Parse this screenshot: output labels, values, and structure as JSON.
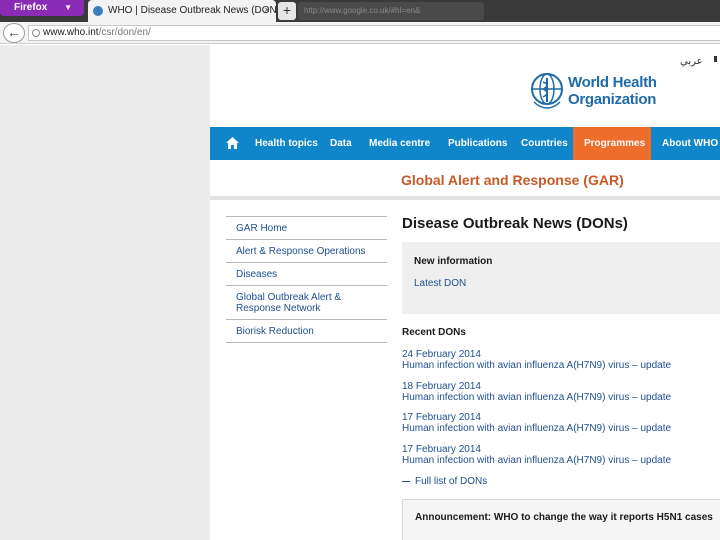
{
  "browser": {
    "app_button_label": "Firefox",
    "tab_title": "WHO | Disease Outbreak News (DONs)",
    "tab_close": "×",
    "new_tab": "+",
    "ghost_tab_text": "http://www.google.co.uk/#hl=en&",
    "url_host": "www.who.int",
    "url_path": "/csr/don/en/"
  },
  "header": {
    "language_link": "عربي",
    "logo_line1": "World Health",
    "logo_line2": "Organization"
  },
  "topnav": {
    "items": [
      {
        "label": "Health topics"
      },
      {
        "label": "Data"
      },
      {
        "label": "Media centre"
      },
      {
        "label": "Publications"
      },
      {
        "label": "Countries"
      },
      {
        "label": "Programmes",
        "active": true
      },
      {
        "label": "About WHO"
      }
    ],
    "bar_color": "#0f86c9",
    "active_color": "#ee6d2a"
  },
  "section_title": "Global Alert and Response (GAR)",
  "sidebar": {
    "items": [
      {
        "label": "GAR Home"
      },
      {
        "label": "Alert & Response Operations"
      },
      {
        "label": "Diseases"
      },
      {
        "label": "Global Outbreak Alert & Response Network"
      },
      {
        "label": "Biorisk Reduction"
      }
    ]
  },
  "main": {
    "page_title": "Disease Outbreak News (DONs)",
    "new_info_title": "New information",
    "latest_link": "Latest DON",
    "recent_title": "Recent DONs",
    "recent": [
      {
        "date": "24 February 2014",
        "desc": "Human infection with avian influenza A(H7N9) virus – update"
      },
      {
        "date": "18 February 2014",
        "desc": "Human infection with avian influenza A(H7N9) virus – update"
      },
      {
        "date": "17 February 2014",
        "desc": "Human infection with avian influenza A(H7N9) virus – update"
      },
      {
        "date": "17 February 2014",
        "desc": "Human infection with avian influenza A(H7N9) virus – update"
      }
    ],
    "full_list_link": "Full list of DONs",
    "announcement": "Announcement: WHO to change the way it reports H5N1 cases"
  }
}
